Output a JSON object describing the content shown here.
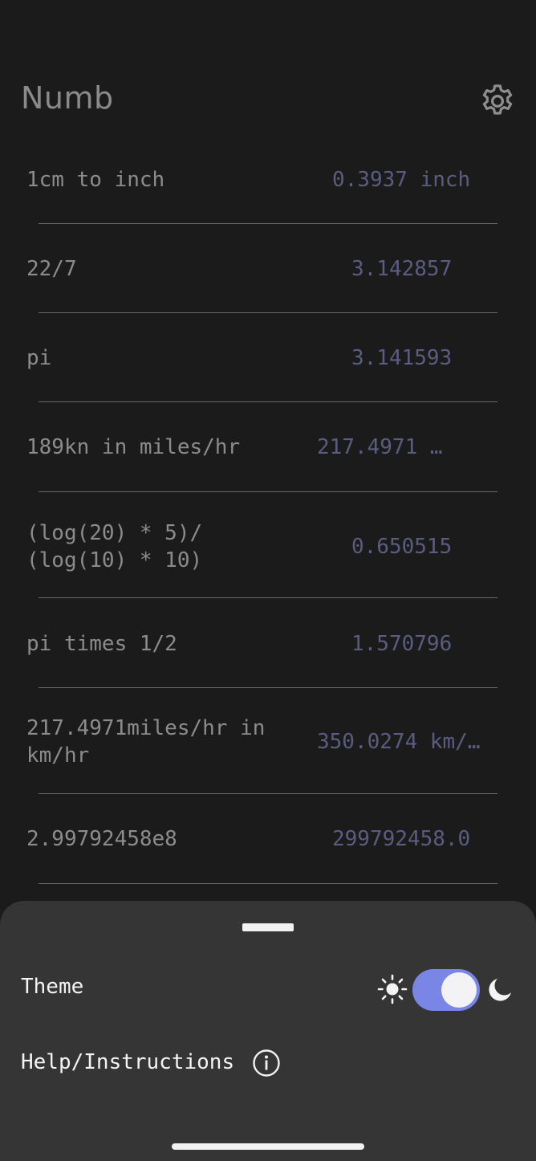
{
  "app": {
    "title": "Numb"
  },
  "colors": {
    "background": "#1b1b1c",
    "expression_text": "#8c8c8c",
    "result_text": "#5a5c80",
    "sheet_background": "#353536",
    "toggle_accent": "#7a86e6"
  },
  "header": {
    "settings_icon": "gear-icon"
  },
  "calculations": [
    {
      "expression": "1cm to inch",
      "result": "0.3937 inch"
    },
    {
      "expression": "22/7",
      "result": "3.142857"
    },
    {
      "expression": "pi",
      "result": "3.141593"
    },
    {
      "expression": "189kn in miles/hr",
      "result": "217.4971 …"
    },
    {
      "expression": "(log(20) * 5)/\n(log(10) * 10)",
      "result": "0.650515"
    },
    {
      "expression": "pi times 1/2",
      "result": "1.570796"
    },
    {
      "expression": "217.4971miles/hr in\nkm/hr",
      "result": "350.0274 km/…"
    },
    {
      "expression": "2.99792458e8",
      "result": "299792458.0"
    }
  ],
  "sheet": {
    "theme_label": "Theme",
    "theme_mode": "dark",
    "theme_icons": {
      "light": "sun-icon",
      "dark": "moon-icon"
    },
    "help_label": "Help/Instructions",
    "help_icon": "info-icon"
  }
}
